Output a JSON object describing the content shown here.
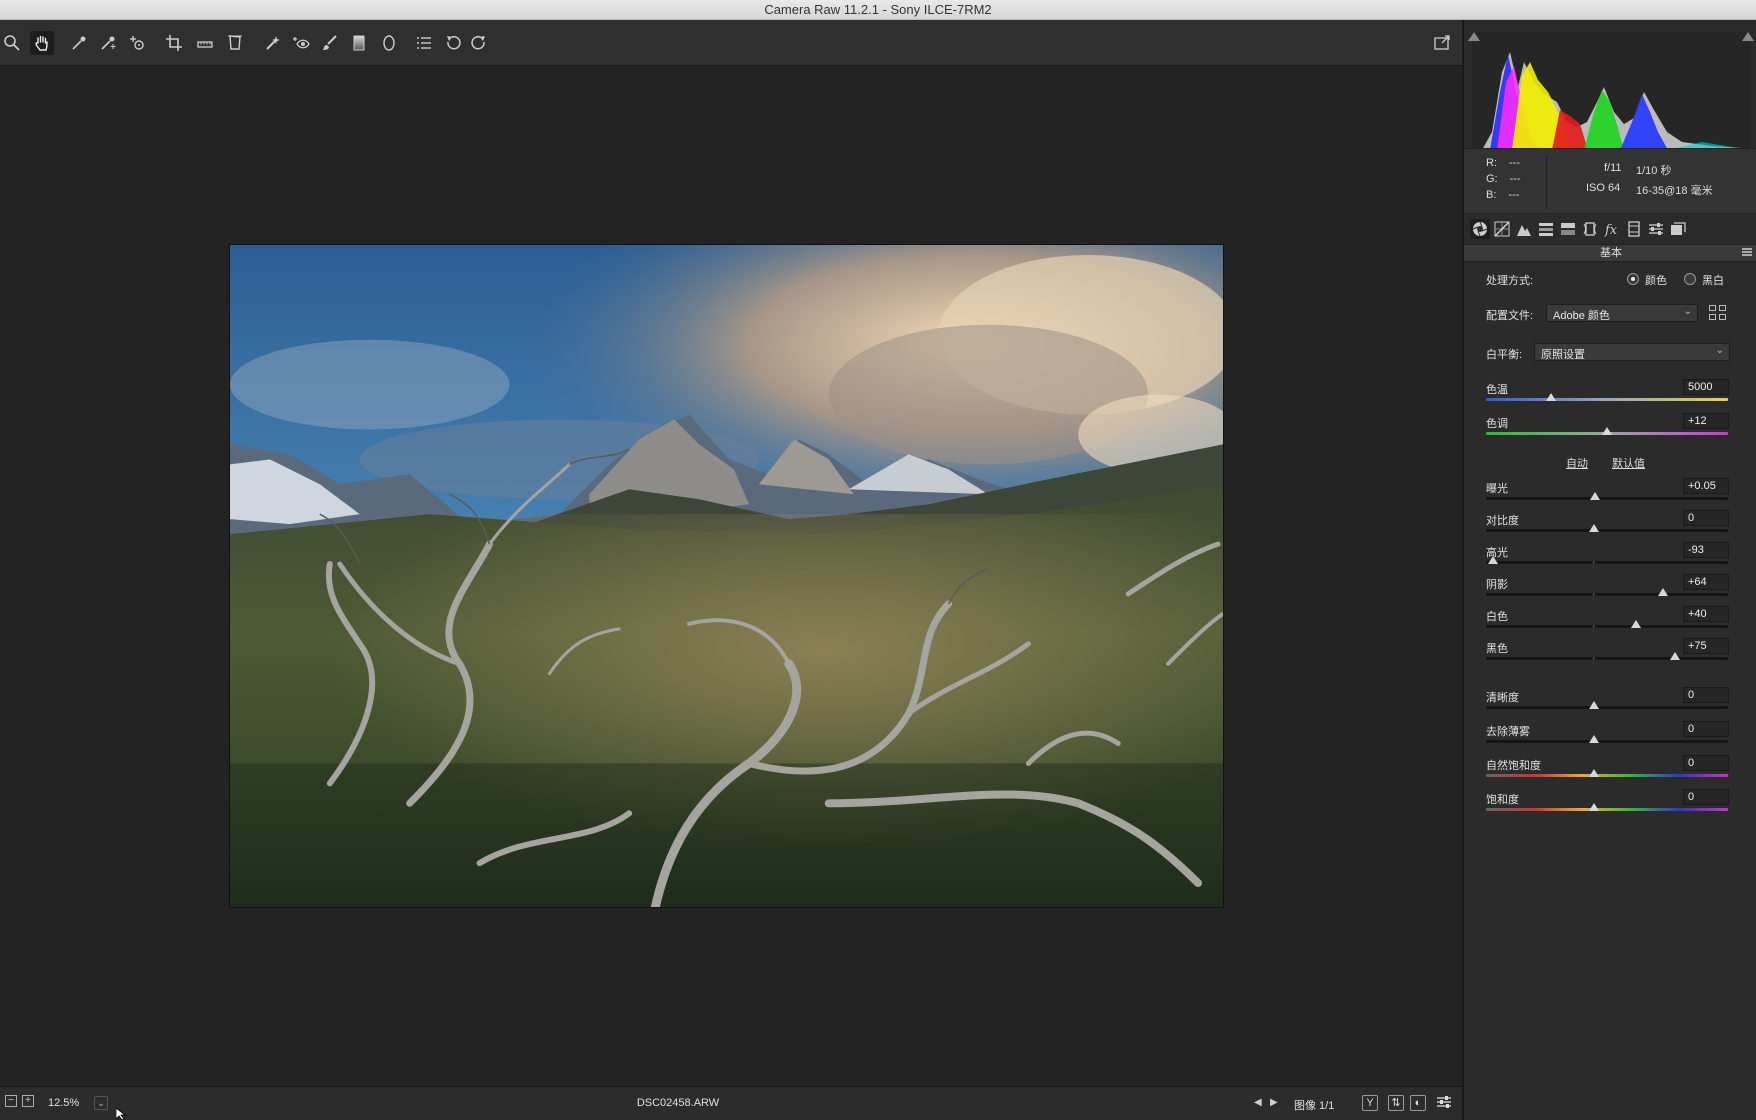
{
  "window": {
    "title": "Camera Raw 11.2.1 -  Sony ILCE-7RM2"
  },
  "toolbar": {
    "tools": [
      {
        "name": "zoom-tool",
        "icon": "magnifier-icon"
      },
      {
        "name": "hand-tool",
        "icon": "hand-icon",
        "active": true
      },
      {
        "name": "white-balance-tool",
        "icon": "eyedropper-icon"
      },
      {
        "name": "color-sampler-tool",
        "icon": "color-sampler-icon"
      },
      {
        "name": "targeted-adjustment-tool",
        "icon": "target-adjust-icon"
      },
      {
        "name": "crop-tool",
        "icon": "crop-icon"
      },
      {
        "name": "straighten-tool",
        "icon": "ruler-icon"
      },
      {
        "name": "transform-tool",
        "icon": "transform-icon"
      },
      {
        "name": "spot-removal-tool",
        "icon": "healing-icon"
      },
      {
        "name": "red-eye-tool",
        "icon": "red-eye-icon"
      },
      {
        "name": "adjustment-brush-tool",
        "icon": "brush-icon"
      },
      {
        "name": "graduated-filter-tool",
        "icon": "gradient-icon"
      },
      {
        "name": "radial-filter-tool",
        "icon": "ellipse-icon"
      },
      {
        "name": "preferences-tool",
        "icon": "list-icon"
      },
      {
        "name": "rotate-left-tool",
        "icon": "rotate-ccw-icon"
      },
      {
        "name": "rotate-right-tool",
        "icon": "rotate-cw-icon"
      }
    ]
  },
  "status": {
    "zoom_minus": "−",
    "zoom_plus": "+",
    "zoom_value": "12.5%",
    "filename": "DSC02458.ARW",
    "image_counter": "图像 1/1"
  },
  "info": {
    "r_label": "R:",
    "r_value": "---",
    "g_label": "G:",
    "g_value": "---",
    "b_label": "B:",
    "b_value": "---",
    "aperture": "f/11",
    "shutter": "1/10 秒",
    "iso": "ISO 64",
    "lens": "16-35@18 毫米"
  },
  "panel": {
    "section_title": "基本",
    "treatment_label": "处理方式:",
    "treatment_color": "颜色",
    "treatment_bw": "黑白",
    "profile_label": "配置文件:",
    "profile_value": "Adobe 颜色",
    "wb_label": "白平衡:",
    "wb_value": "原照设置",
    "auto_link": "自动",
    "default_link": "默认值",
    "sliders": [
      {
        "key": "temp",
        "label": "色温",
        "value": "5000",
        "pos": 0.27
      },
      {
        "key": "tint",
        "label": "色调",
        "value": "+12",
        "pos": 0.5
      },
      {
        "key": "exposure",
        "label": "曝光",
        "value": "+0.05",
        "pos": 0.45
      },
      {
        "key": "contrast",
        "label": "对比度",
        "value": "0",
        "pos": 0.445
      },
      {
        "key": "highlights",
        "label": "高光",
        "value": "-93",
        "pos": 0.03
      },
      {
        "key": "shadows",
        "label": "阴影",
        "value": "+64",
        "pos": 0.73
      },
      {
        "key": "whites",
        "label": "白色",
        "value": "+40",
        "pos": 0.62
      },
      {
        "key": "blacks",
        "label": "黑色",
        "value": "+75",
        "pos": 0.78
      },
      {
        "key": "clarity",
        "label": "清晰度",
        "value": "0",
        "pos": 0.445
      },
      {
        "key": "dehaze",
        "label": "去除薄雾",
        "value": "0",
        "pos": 0.445
      },
      {
        "key": "vibrance",
        "label": "自然饱和度",
        "value": "0",
        "pos": 0.445
      },
      {
        "key": "saturation",
        "label": "饱和度",
        "value": "0",
        "pos": 0.445
      }
    ]
  },
  "colors": {
    "accent": "#d8d8d8",
    "panel_bg": "#2b2b2b",
    "canvas_bg": "#232323"
  }
}
